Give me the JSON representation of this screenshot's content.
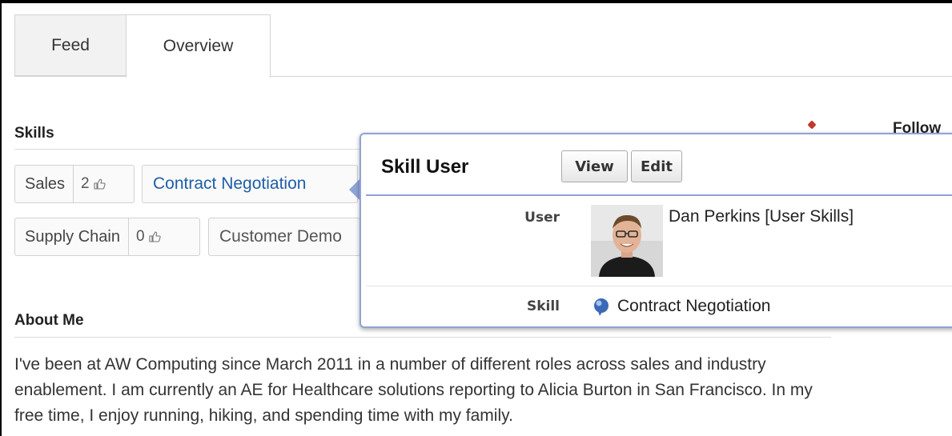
{
  "tabs": [
    {
      "label": "Feed"
    },
    {
      "label": "Overview"
    }
  ],
  "skills_section": {
    "heading": "Skills",
    "chips": [
      {
        "name": "Sales",
        "count": "2"
      },
      {
        "name": "Contract Negotiation"
      },
      {
        "name": "Supply Chain",
        "count": "0"
      },
      {
        "name": "Customer Demo"
      }
    ]
  },
  "about_section": {
    "heading": "About Me",
    "text": "I've been at AW Computing since March 2011 in a number of different roles across sales and industry enablement. I am currently an AE for Healthcare solutions reporting to Alicia Burton in San Francisco. In my free time, I enjoy running, hiking, and spending time with my family."
  },
  "right_column": {
    "follow_label": "Follow"
  },
  "popover": {
    "title": "Skill User",
    "view_label": "View",
    "edit_label": "Edit",
    "user_label": "User",
    "user_value": "Dan Perkins [User Skills]",
    "skill_label": "Skill",
    "skill_value": "Contract Negotiation",
    "accent_color": "#8fa3d6"
  },
  "colors": {
    "link": "#1f5ea8",
    "tab_inactive_bg": "#f2f2f2",
    "chip_border": "#d2d2d2"
  },
  "icons": [
    "thumbs-up-icon",
    "pencil-icon",
    "skill-bubble-icon"
  ]
}
